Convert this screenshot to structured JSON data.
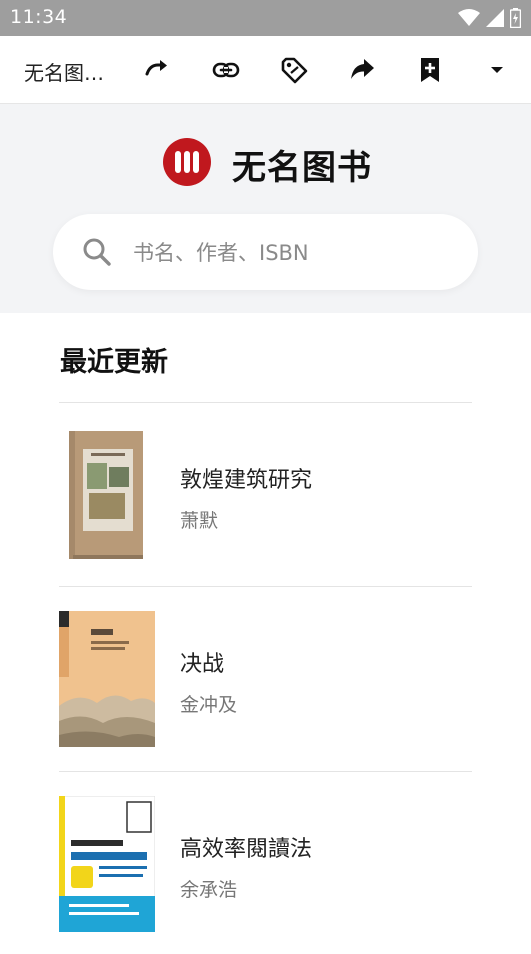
{
  "status_bar": {
    "time": "11:34"
  },
  "toolbar": {
    "title": "无名图…"
  },
  "brand": {
    "name": "无名图书"
  },
  "search": {
    "placeholder": "书名、作者、ISBN"
  },
  "section": {
    "title": "最近更新"
  },
  "books": [
    {
      "title": "敦煌建筑研究",
      "author": "萧默"
    },
    {
      "title": "决战",
      "author": "金冲及"
    },
    {
      "title": "高效率閱讀法",
      "author": "余承浩"
    }
  ],
  "colors": {
    "brand_red": "#c0181e",
    "hero_bg": "#f3f4f6",
    "status_bar": "#9e9e9e"
  }
}
